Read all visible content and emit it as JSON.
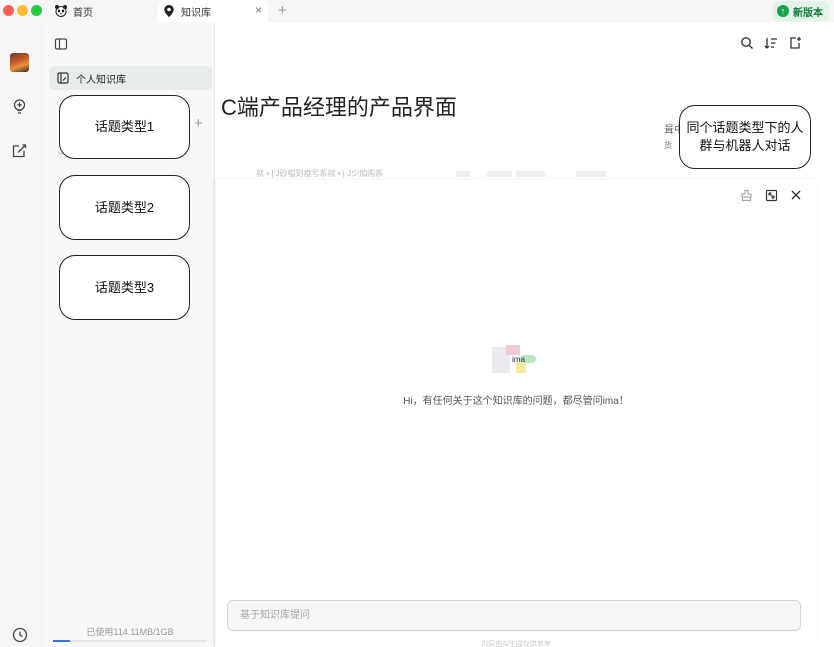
{
  "titlebar": {
    "tabs": [
      {
        "label": "首页",
        "icon": "panda-icon"
      },
      {
        "label": "知识库",
        "icon": "location-pin-icon"
      }
    ],
    "close_glyph": "×",
    "add_glyph": "+",
    "new_version_label": "新版本"
  },
  "sidebar": {
    "personal_kb_label": "个人知识库",
    "add_glyph": "+",
    "usage_text": "已使用114.11MB/1GB",
    "usage_fraction": 0.111
  },
  "annotations": {
    "topic1": "话题类型1",
    "topic2": "话题类型2",
    "topic3": "话题类型3",
    "group_note": "同个话题类型下的人群与机器人对话"
  },
  "document": {
    "title": "C端产品经理的产品界面",
    "strip_text": "就 • | J砂帽到疫亏系就 • | J少加购系",
    "right_fragment": "咠中",
    "right_fragment2": "货"
  },
  "chat": {
    "greeting": "Hi，有任何关于这个知识库的问题，都尽管问ima！",
    "input_placeholder": "基于知识库提问",
    "footer": "内容由AI生成仅供参考",
    "logo_text": "ima"
  },
  "colors": {
    "accent_green": "#17a34a",
    "progress_blue": "#3b6cf6"
  }
}
